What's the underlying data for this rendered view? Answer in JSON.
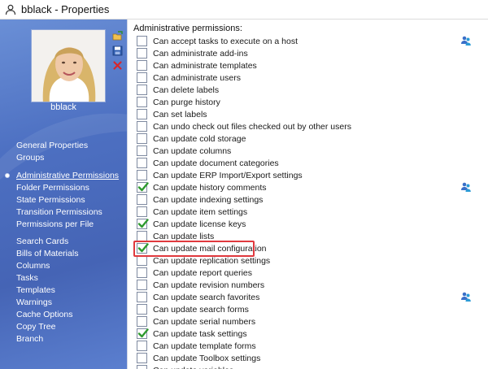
{
  "window": {
    "title": "bblack - Properties"
  },
  "user": {
    "name": "bblack"
  },
  "sidebar": {
    "tools": [
      {
        "icon": "open-folder-icon"
      },
      {
        "icon": "save-icon"
      },
      {
        "icon": "delete-icon"
      }
    ],
    "nav_groups": [
      [
        "General Properties",
        "Groups"
      ],
      [
        "Administrative Permissions",
        "Folder Permissions",
        "State Permissions",
        "Transition Permissions",
        "Permissions per File"
      ],
      [
        "Search Cards",
        "Bills of Materials",
        "Columns",
        "Tasks",
        "Templates",
        "Warnings",
        "Cache Options",
        "Copy Tree",
        "Branch"
      ]
    ],
    "active_item": "Administrative Permissions"
  },
  "permissions": {
    "title": "Administrative permissions:",
    "items": [
      {
        "label": "Can accept tasks to execute on a host",
        "checked": false,
        "users_icon": true
      },
      {
        "label": "Can administrate add-ins",
        "checked": false,
        "users_icon": false
      },
      {
        "label": "Can administrate templates",
        "checked": false,
        "users_icon": false
      },
      {
        "label": "Can administrate users",
        "checked": false,
        "users_icon": false
      },
      {
        "label": "Can delete labels",
        "checked": false,
        "users_icon": false
      },
      {
        "label": "Can purge history",
        "checked": false,
        "users_icon": false
      },
      {
        "label": "Can set labels",
        "checked": false,
        "users_icon": false
      },
      {
        "label": "Can undo check out files checked out by other users",
        "checked": false,
        "users_icon": false
      },
      {
        "label": "Can update cold storage",
        "checked": false,
        "users_icon": false
      },
      {
        "label": "Can update columns",
        "checked": false,
        "users_icon": false
      },
      {
        "label": "Can update document categories",
        "checked": false,
        "users_icon": false
      },
      {
        "label": "Can update ERP Import/Export settings",
        "checked": false,
        "users_icon": false
      },
      {
        "label": "Can update history comments",
        "checked": true,
        "users_icon": true
      },
      {
        "label": "Can update indexing settings",
        "checked": false,
        "users_icon": false
      },
      {
        "label": "Can update item settings",
        "checked": false,
        "users_icon": false
      },
      {
        "label": "Can update license keys",
        "checked": true,
        "users_icon": false
      },
      {
        "label": "Can update lists",
        "checked": false,
        "users_icon": false
      },
      {
        "label": "Can update mail configuration",
        "checked": true,
        "users_icon": false
      },
      {
        "label": "Can update replication settings",
        "checked": false,
        "users_icon": false
      },
      {
        "label": "Can update report queries",
        "checked": false,
        "users_icon": false
      },
      {
        "label": "Can update revision numbers",
        "checked": false,
        "users_icon": false
      },
      {
        "label": "Can update search favorites",
        "checked": false,
        "users_icon": true
      },
      {
        "label": "Can update search forms",
        "checked": false,
        "users_icon": false
      },
      {
        "label": "Can update serial numbers",
        "checked": false,
        "users_icon": false
      },
      {
        "label": "Can update task settings",
        "checked": true,
        "users_icon": false
      },
      {
        "label": "Can update template forms",
        "checked": false,
        "users_icon": false
      },
      {
        "label": "Can update Toolbox settings",
        "checked": false,
        "users_icon": false
      },
      {
        "label": "Can update variables",
        "checked": false,
        "users_icon": false
      }
    ],
    "highlighted": "Can update mail configuration"
  },
  "colors": {
    "sidebar_blue": "#4d70c2",
    "check_green": "#2f9a2f",
    "highlight_red": "#e0393e"
  }
}
